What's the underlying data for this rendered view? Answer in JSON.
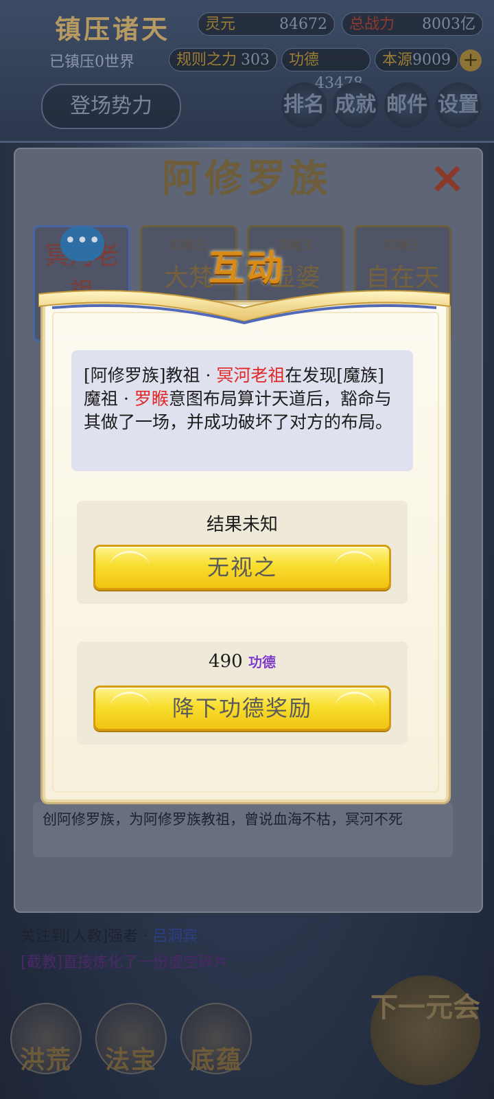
{
  "background": {
    "game_title": "镇压诸天",
    "subtitle": "已镇压0世界",
    "stats": {
      "lingyuan_label": "灵元",
      "lingyuan_value": "84672",
      "zhanli_label": "总战力",
      "zhanli_value": "8003亿",
      "guize_label": "规则之力",
      "guize_value": "303",
      "gongde_label": "功德",
      "gongde_value": "43478",
      "benyuan_label": "本源",
      "benyuan_value": "9009"
    },
    "enter_button": "登场势力",
    "top_icons": [
      "排名",
      "成就",
      "邮件",
      "设置"
    ],
    "panel_title": "阿修罗族",
    "char_cards": [
      {
        "tag": "",
        "name": "冥河老祖"
      },
      {
        "tag": "四魔王",
        "name": "大梵"
      },
      {
        "tag": "四魔王",
        "name": "显婆"
      },
      {
        "tag": "四魔王",
        "name": "自在天"
      }
    ],
    "description": "创阿修罗族，为阿修罗族教祖，曾说血海不枯，冥河不死",
    "log_lines": [
      {
        "prefix": "关注到[人教]强者 · ",
        "name": "吕洞宾"
      },
      {
        "prefix": "[截教]直接炼化了一份虚空碎片",
        "name": ""
      }
    ],
    "bottom_nav": [
      "洪荒",
      "法宝",
      "底蕴"
    ],
    "next_era": "下一元会"
  },
  "modal": {
    "title": "互动",
    "story": {
      "part1": "[阿修罗族]教祖 · ",
      "name1": "冥河老祖",
      "part2": "在发现[魔族]魔祖 · ",
      "name2": "罗睺",
      "part3": "意图布局算计天道后，豁命与其做了一场，并成功破坏了对方的布局。"
    },
    "option1": {
      "label": "结果未知",
      "button": "无视之"
    },
    "option2": {
      "amount": "490",
      "unit": "功德",
      "button": "降下功德奖励"
    }
  },
  "colors": {
    "highlight_red": "#e02828",
    "button_gold": "#f8de2e",
    "merit_purple": "#7c3bc6"
  }
}
